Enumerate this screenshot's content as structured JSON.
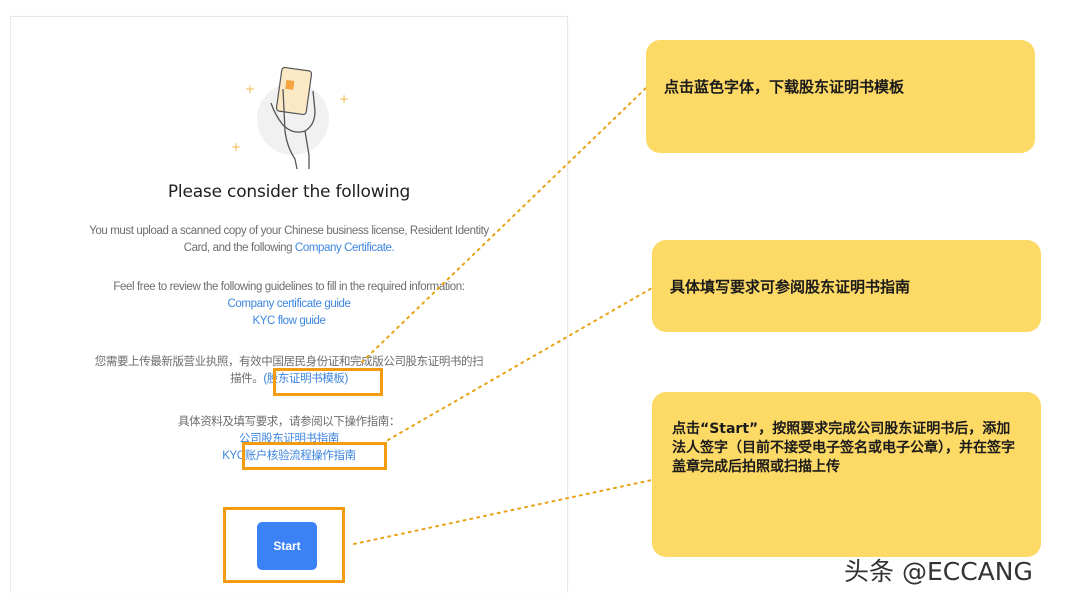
{
  "panel": {
    "title": "Please consider the following",
    "para1_text": "You must upload a scanned copy of your Chinese business license, Resident Identity Card, and the following ",
    "para1_link": "Company Certificate.",
    "para2_text": "Feel free to review the following guidelines to fill in the required information:",
    "guide_links": [
      "Company certificate guide",
      "KYC flow guide"
    ],
    "cn_para1_text": "您需要上传最新版营业执照，有效中国居民身份证和完成版公司股东证明书的扫描件。",
    "cn_para1_link": "(股东证明书模板)",
    "cn_para2_text": "具体资料及填写要求，请参阅以下操作指南：",
    "cn_guide_links": [
      "公司股东证明书指南",
      "KYC账户核验流程操作指南"
    ],
    "start_button": "Start"
  },
  "callouts": [
    {
      "text": "点击蓝色字体，下载股东证明书模板"
    },
    {
      "text": "具体填写要求可参阅股东证明书指南"
    },
    {
      "text": "点击“Start”，按照要求完成公司股东证明书后，添加法人签字（目前不接受电子签名或电子公章），并在签字盖章完成后拍照或扫描上传"
    }
  ],
  "watermark": "头条 @ECCANG",
  "colors": {
    "link": "#3d86e0",
    "button": "#3b82f6",
    "highlight": "#f39c12",
    "callout": "#fdd966",
    "dotted_line": "#e8a317"
  }
}
